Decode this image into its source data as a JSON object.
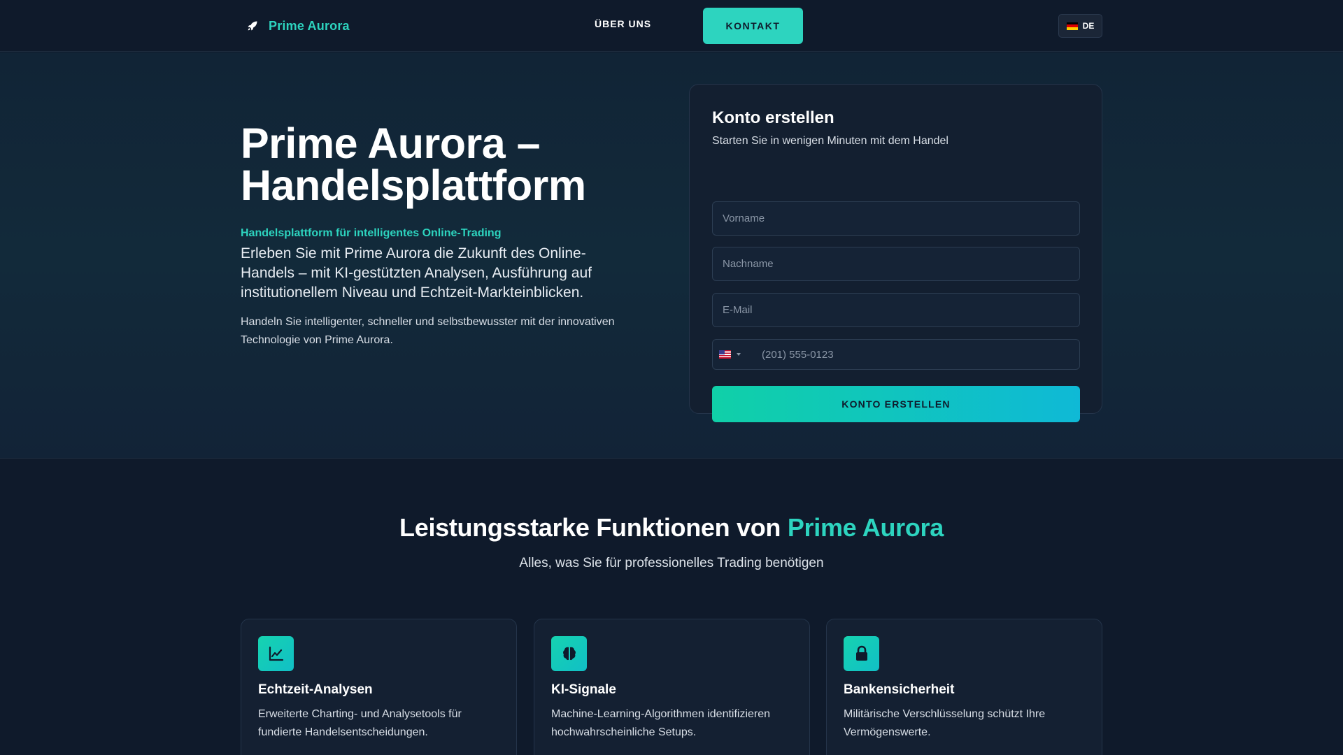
{
  "nav": {
    "brand": "Prime Aurora",
    "about": "ÜBER UNS",
    "contact": "KONTAKT",
    "language": "DE"
  },
  "hero": {
    "title": "Prime Aurora – Handelsplattform",
    "tagline": "Handelsplattform für intelligentes Online-Trading",
    "lead": "Erleben Sie mit Prime Aurora die Zukunft des Online-Handels – mit KI-gestützten Analysen, Ausführung auf institutionellem Niveau und Echtzeit-Markteinblicken.",
    "sub": "Handeln Sie intelligenter, schneller und selbstbewusster mit der innovativen Technologie von Prime Aurora."
  },
  "form": {
    "title": "Konto erstellen",
    "subtitle": "Starten Sie in wenigen Minuten mit dem Handel",
    "firstname_placeholder": "Vorname",
    "lastname_placeholder": "Nachname",
    "email_placeholder": "E-Mail",
    "phone_placeholder": "(201) 555-0123",
    "submit": "KONTO ERSTELLEN"
  },
  "features": {
    "title_prefix": "Leistungsstarke Funktionen von ",
    "title_accent": "Prime Aurora",
    "subtitle": "Alles, was Sie für professionelles Trading benötigen",
    "items": [
      {
        "icon": "chart-line-icon",
        "title": "Echtzeit-Analysen",
        "description": "Erweiterte Charting- und Analysetools für fundierte Handelsentscheidungen."
      },
      {
        "icon": "brain-icon",
        "title": "KI-Signale",
        "description": "Machine-Learning-Algorithmen identifizieren hochwahrscheinliche Setups."
      },
      {
        "icon": "lock-icon",
        "title": "Bankensicherheit",
        "description": "Militärische Verschlüsselung schützt Ihre Vermögenswerte."
      }
    ]
  },
  "colors": {
    "background": "#0f1a2b",
    "accent": "#2dd4bf",
    "card": "#131f30"
  }
}
